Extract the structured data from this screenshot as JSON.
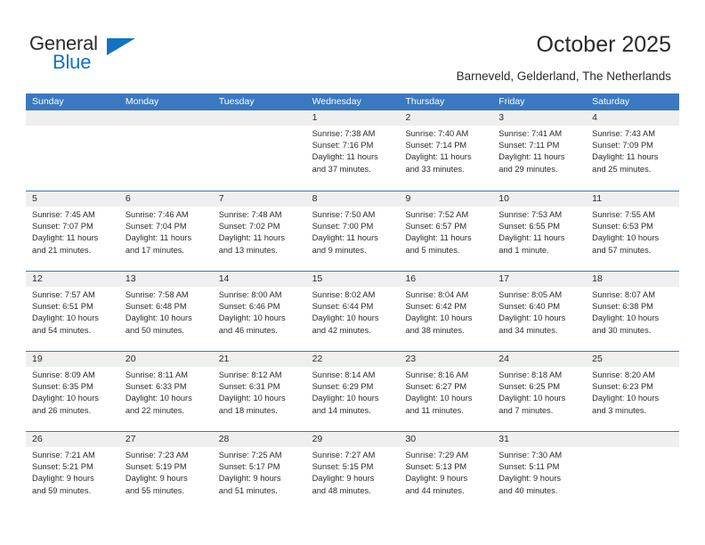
{
  "brand": {
    "name_part1": "General",
    "name_part2": "Blue",
    "triangle_icon": "triangle-icon",
    "accent_color": "#1273c4"
  },
  "header": {
    "title": "October 2025",
    "location": "Barneveld, Gelderland, The Netherlands"
  },
  "calendar": {
    "header_bg": "#3a79c0",
    "daynum_bg": "#efefef",
    "weekdays": [
      "Sunday",
      "Monday",
      "Tuesday",
      "Wednesday",
      "Thursday",
      "Friday",
      "Saturday"
    ],
    "weeks": [
      [
        {
          "empty": true
        },
        {
          "empty": true
        },
        {
          "empty": true
        },
        {
          "day": "1",
          "sunrise": "Sunrise: 7:38 AM",
          "sunset": "Sunset: 7:16 PM",
          "daylight1": "Daylight: 11 hours",
          "daylight2": "and 37 minutes."
        },
        {
          "day": "2",
          "sunrise": "Sunrise: 7:40 AM",
          "sunset": "Sunset: 7:14 PM",
          "daylight1": "Daylight: 11 hours",
          "daylight2": "and 33 minutes."
        },
        {
          "day": "3",
          "sunrise": "Sunrise: 7:41 AM",
          "sunset": "Sunset: 7:11 PM",
          "daylight1": "Daylight: 11 hours",
          "daylight2": "and 29 minutes."
        },
        {
          "day": "4",
          "sunrise": "Sunrise: 7:43 AM",
          "sunset": "Sunset: 7:09 PM",
          "daylight1": "Daylight: 11 hours",
          "daylight2": "and 25 minutes."
        }
      ],
      [
        {
          "day": "5",
          "sunrise": "Sunrise: 7:45 AM",
          "sunset": "Sunset: 7:07 PM",
          "daylight1": "Daylight: 11 hours",
          "daylight2": "and 21 minutes."
        },
        {
          "day": "6",
          "sunrise": "Sunrise: 7:46 AM",
          "sunset": "Sunset: 7:04 PM",
          "daylight1": "Daylight: 11 hours",
          "daylight2": "and 17 minutes."
        },
        {
          "day": "7",
          "sunrise": "Sunrise: 7:48 AM",
          "sunset": "Sunset: 7:02 PM",
          "daylight1": "Daylight: 11 hours",
          "daylight2": "and 13 minutes."
        },
        {
          "day": "8",
          "sunrise": "Sunrise: 7:50 AM",
          "sunset": "Sunset: 7:00 PM",
          "daylight1": "Daylight: 11 hours",
          "daylight2": "and 9 minutes."
        },
        {
          "day": "9",
          "sunrise": "Sunrise: 7:52 AM",
          "sunset": "Sunset: 6:57 PM",
          "daylight1": "Daylight: 11 hours",
          "daylight2": "and 5 minutes."
        },
        {
          "day": "10",
          "sunrise": "Sunrise: 7:53 AM",
          "sunset": "Sunset: 6:55 PM",
          "daylight1": "Daylight: 11 hours",
          "daylight2": "and 1 minute."
        },
        {
          "day": "11",
          "sunrise": "Sunrise: 7:55 AM",
          "sunset": "Sunset: 6:53 PM",
          "daylight1": "Daylight: 10 hours",
          "daylight2": "and 57 minutes."
        }
      ],
      [
        {
          "day": "12",
          "sunrise": "Sunrise: 7:57 AM",
          "sunset": "Sunset: 6:51 PM",
          "daylight1": "Daylight: 10 hours",
          "daylight2": "and 54 minutes."
        },
        {
          "day": "13",
          "sunrise": "Sunrise: 7:58 AM",
          "sunset": "Sunset: 6:48 PM",
          "daylight1": "Daylight: 10 hours",
          "daylight2": "and 50 minutes."
        },
        {
          "day": "14",
          "sunrise": "Sunrise: 8:00 AM",
          "sunset": "Sunset: 6:46 PM",
          "daylight1": "Daylight: 10 hours",
          "daylight2": "and 46 minutes."
        },
        {
          "day": "15",
          "sunrise": "Sunrise: 8:02 AM",
          "sunset": "Sunset: 6:44 PM",
          "daylight1": "Daylight: 10 hours",
          "daylight2": "and 42 minutes."
        },
        {
          "day": "16",
          "sunrise": "Sunrise: 8:04 AM",
          "sunset": "Sunset: 6:42 PM",
          "daylight1": "Daylight: 10 hours",
          "daylight2": "and 38 minutes."
        },
        {
          "day": "17",
          "sunrise": "Sunrise: 8:05 AM",
          "sunset": "Sunset: 6:40 PM",
          "daylight1": "Daylight: 10 hours",
          "daylight2": "and 34 minutes."
        },
        {
          "day": "18",
          "sunrise": "Sunrise: 8:07 AM",
          "sunset": "Sunset: 6:38 PM",
          "daylight1": "Daylight: 10 hours",
          "daylight2": "and 30 minutes."
        }
      ],
      [
        {
          "day": "19",
          "sunrise": "Sunrise: 8:09 AM",
          "sunset": "Sunset: 6:35 PM",
          "daylight1": "Daylight: 10 hours",
          "daylight2": "and 26 minutes."
        },
        {
          "day": "20",
          "sunrise": "Sunrise: 8:11 AM",
          "sunset": "Sunset: 6:33 PM",
          "daylight1": "Daylight: 10 hours",
          "daylight2": "and 22 minutes."
        },
        {
          "day": "21",
          "sunrise": "Sunrise: 8:12 AM",
          "sunset": "Sunset: 6:31 PM",
          "daylight1": "Daylight: 10 hours",
          "daylight2": "and 18 minutes."
        },
        {
          "day": "22",
          "sunrise": "Sunrise: 8:14 AM",
          "sunset": "Sunset: 6:29 PM",
          "daylight1": "Daylight: 10 hours",
          "daylight2": "and 14 minutes."
        },
        {
          "day": "23",
          "sunrise": "Sunrise: 8:16 AM",
          "sunset": "Sunset: 6:27 PM",
          "daylight1": "Daylight: 10 hours",
          "daylight2": "and 11 minutes."
        },
        {
          "day": "24",
          "sunrise": "Sunrise: 8:18 AM",
          "sunset": "Sunset: 6:25 PM",
          "daylight1": "Daylight: 10 hours",
          "daylight2": "and 7 minutes."
        },
        {
          "day": "25",
          "sunrise": "Sunrise: 8:20 AM",
          "sunset": "Sunset: 6:23 PM",
          "daylight1": "Daylight: 10 hours",
          "daylight2": "and 3 minutes."
        }
      ],
      [
        {
          "day": "26",
          "sunrise": "Sunrise: 7:21 AM",
          "sunset": "Sunset: 5:21 PM",
          "daylight1": "Daylight: 9 hours",
          "daylight2": "and 59 minutes."
        },
        {
          "day": "27",
          "sunrise": "Sunrise: 7:23 AM",
          "sunset": "Sunset: 5:19 PM",
          "daylight1": "Daylight: 9 hours",
          "daylight2": "and 55 minutes."
        },
        {
          "day": "28",
          "sunrise": "Sunrise: 7:25 AM",
          "sunset": "Sunset: 5:17 PM",
          "daylight1": "Daylight: 9 hours",
          "daylight2": "and 51 minutes."
        },
        {
          "day": "29",
          "sunrise": "Sunrise: 7:27 AM",
          "sunset": "Sunset: 5:15 PM",
          "daylight1": "Daylight: 9 hours",
          "daylight2": "and 48 minutes."
        },
        {
          "day": "30",
          "sunrise": "Sunrise: 7:29 AM",
          "sunset": "Sunset: 5:13 PM",
          "daylight1": "Daylight: 9 hours",
          "daylight2": "and 44 minutes."
        },
        {
          "day": "31",
          "sunrise": "Sunrise: 7:30 AM",
          "sunset": "Sunset: 5:11 PM",
          "daylight1": "Daylight: 9 hours",
          "daylight2": "and 40 minutes."
        },
        {
          "empty": true
        }
      ]
    ]
  }
}
